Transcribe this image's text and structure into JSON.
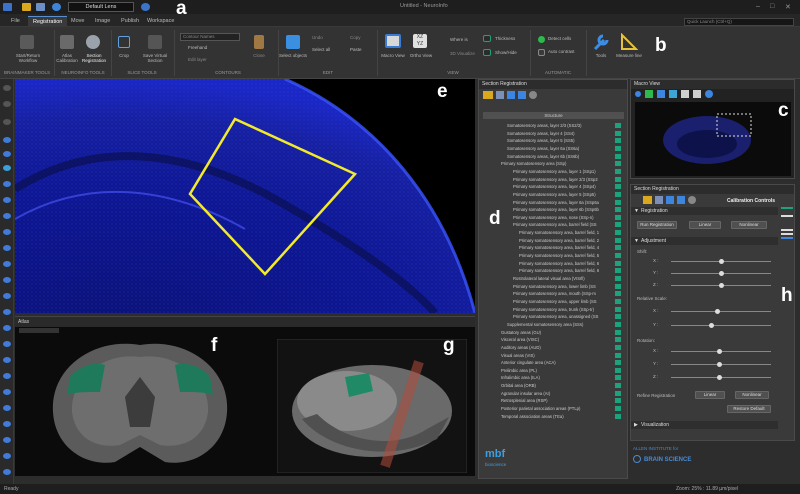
{
  "app": {
    "window_title": "Untitled - NeuroInfo",
    "lens": "Default Lens",
    "quick_launch_placeholder": "Quick Launch (Ctrl+Q)"
  },
  "tabs": [
    "File",
    "Registration",
    "Move",
    "Image",
    "Publish",
    "Workspace"
  ],
  "ribbon": {
    "groups": [
      "BRAINMAKER TOOLS",
      "NEUROINFO TOOLS",
      "SLICE TOOLS",
      "CONTOURS",
      "EDIT",
      "VIEW",
      "AUTOMATIC"
    ],
    "buttons": {
      "brainmaker": "Start/Return Workflow",
      "atlas_calibration": "Atlas Calibration",
      "section_registration": "Section Registration",
      "crop": "Crop",
      "save_virtual": "Save Virtual Section",
      "contour_name": "Contour Names",
      "freehand": "Freehand",
      "edit_layer": "Edit layer",
      "close": "Close",
      "select_objects": "Select objects",
      "undo": "Undo",
      "select_all": "Select all",
      "copy": "Copy",
      "paste": "Paste",
      "macro_view": "Macro View",
      "ortho_view": "Ortho View",
      "where_is": "Where is",
      "view_3d": "3D Visualize",
      "thickness": "Thickness",
      "show_hide": "Show/Hide",
      "detect_cells": "Detect cells",
      "auto_contrast": "Auto contrast",
      "tools": "Tools",
      "measure_line": "Measure line"
    }
  },
  "atlas_panel": {
    "title": "Atlas"
  },
  "section_registration": {
    "title": "Section Registration",
    "column_header": "Structure",
    "rows": [
      "Somatosensory areas, layer 2/3 (SS2/3)",
      "Somatosensory areas, layer 4 (SS4)",
      "Somatosensory areas, layer 5 (SS5)",
      "Somatosensory areas, layer 6a (SS6a)",
      "Somatosensory areas, layer 6b (SS6b)",
      "Primary somatosensory area (SSp)",
      "Primary somatosensory area, layer 1 (SSp1)",
      "Primary somatosensory area, layer 2/3 (SSp2",
      "Primary somatosensory area, layer 4 (SSp4)",
      "Primary somatosensory area, layer 5 (SSp5)",
      "Primary somatosensory area, layer 6a (SSp6a",
      "Primary somatosensory area, layer 6b (SSp6b",
      "Primary somatosensory area, nose (SSp-n)",
      "Primary somatosensory area, barrel field (SS",
      "Primary somatosensory area, barrel field, 1",
      "Primary somatosensory area, barrel field, 2",
      "Primary somatosensory area, barrel field, 4",
      "Primary somatosensory area, barrel field, 5",
      "Primary somatosensory area, barrel field, 6",
      "Primary somatosensory area, barrel field, 6",
      "Rostrolateral lateral visual area (VISrll)",
      "Primary somatosensory area, lower limb (SS",
      "Primary somatosensory area, mouth (SSp-m",
      "Primary somatosensory area, upper limb (SS",
      "Primary somatosensory area, trunk (SSp-tr)",
      "Primary somatosensory area, unassigned (SS",
      "Supplemental somatosensory area (SSs)",
      "Gustatory areas (GU)",
      "Visceral area (VISC)",
      "Auditory areas (AUD)",
      "Visual areas (VIS)",
      "Anterior cingulate area (ACA)",
      "Prelimbic area (PL)",
      "Infralimbic area (ILA)",
      "Orbital area (ORB)",
      "Agranular insular area (AI)",
      "Retrosplenial area (RSP)",
      "Posterior parietal association areas (PTLp)",
      "Temporal association areas (TEa)"
    ]
  },
  "macro_view": {
    "title": "Macro View"
  },
  "calibration": {
    "title": "Section Registration",
    "controls_title": "Calibration Controls",
    "registration_header": "Registration",
    "btn_run": "Run Registration",
    "btn_linear": "Linear",
    "btn_nonlinear": "Nonlinear",
    "adjustment_header": "Adjustment",
    "shift_label": "Shift:",
    "relscale_label": "Relative Scale:",
    "rotation_label": "Rotation:",
    "refine_label": "Refine Registration",
    "btn_refine_linear": "Linear",
    "btn_refine_nonlinear": "Nonlinear",
    "btn_restore": "Restore Default",
    "visualization_header": "Visualization",
    "axis_x": "X :",
    "axis_y": "Y :",
    "axis_z": "Z :"
  },
  "logos": {
    "mbf": "mbf",
    "mbf_sub": "bioscience",
    "allen_top": "ALLEN INSTITUTE for",
    "allen": "BRAIN SCIENCE"
  },
  "status": {
    "left": "Ready",
    "right": "Zoom: 25% : 11.89 µm/pixel"
  },
  "figure_labels": [
    "a",
    "b",
    "c",
    "d",
    "e",
    "f",
    "g",
    "h"
  ],
  "colors": {
    "accent": "#1da37c",
    "contour": "#f2ea2a",
    "nissl": "#1f2ed8"
  }
}
